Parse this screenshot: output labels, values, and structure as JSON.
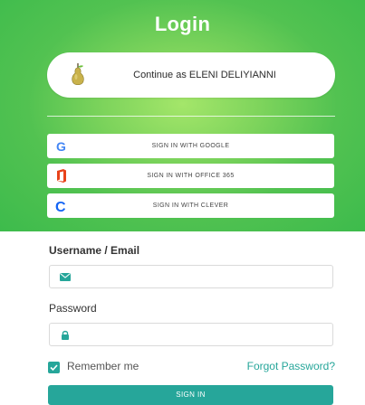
{
  "header": {
    "title": "Login"
  },
  "continue": {
    "label": "Continue as ELENI DELIYIANNI",
    "icon": "pear-icon"
  },
  "sso": {
    "google": {
      "label": "SIGN IN WITH GOOGLE",
      "icon": "google-icon"
    },
    "office": {
      "label": "SIGN IN WITH OFFICE 365",
      "icon": "office365-icon"
    },
    "clever": {
      "label": "SIGN IN WITH CLEVER",
      "icon": "clever-icon"
    }
  },
  "form": {
    "username_label": "Username / Email",
    "username_value": "",
    "username_icon": "envelope-icon",
    "password_label": "Password",
    "password_value": "",
    "password_icon": "lock-icon",
    "remember_label": "Remember me",
    "remember_checked": true,
    "forgot_label": "Forgot Password?",
    "submit_label": "SIGN IN"
  },
  "colors": {
    "accent": "#26a69a",
    "hero_green": "#52c251",
    "hero_light": "#a4e66a"
  }
}
